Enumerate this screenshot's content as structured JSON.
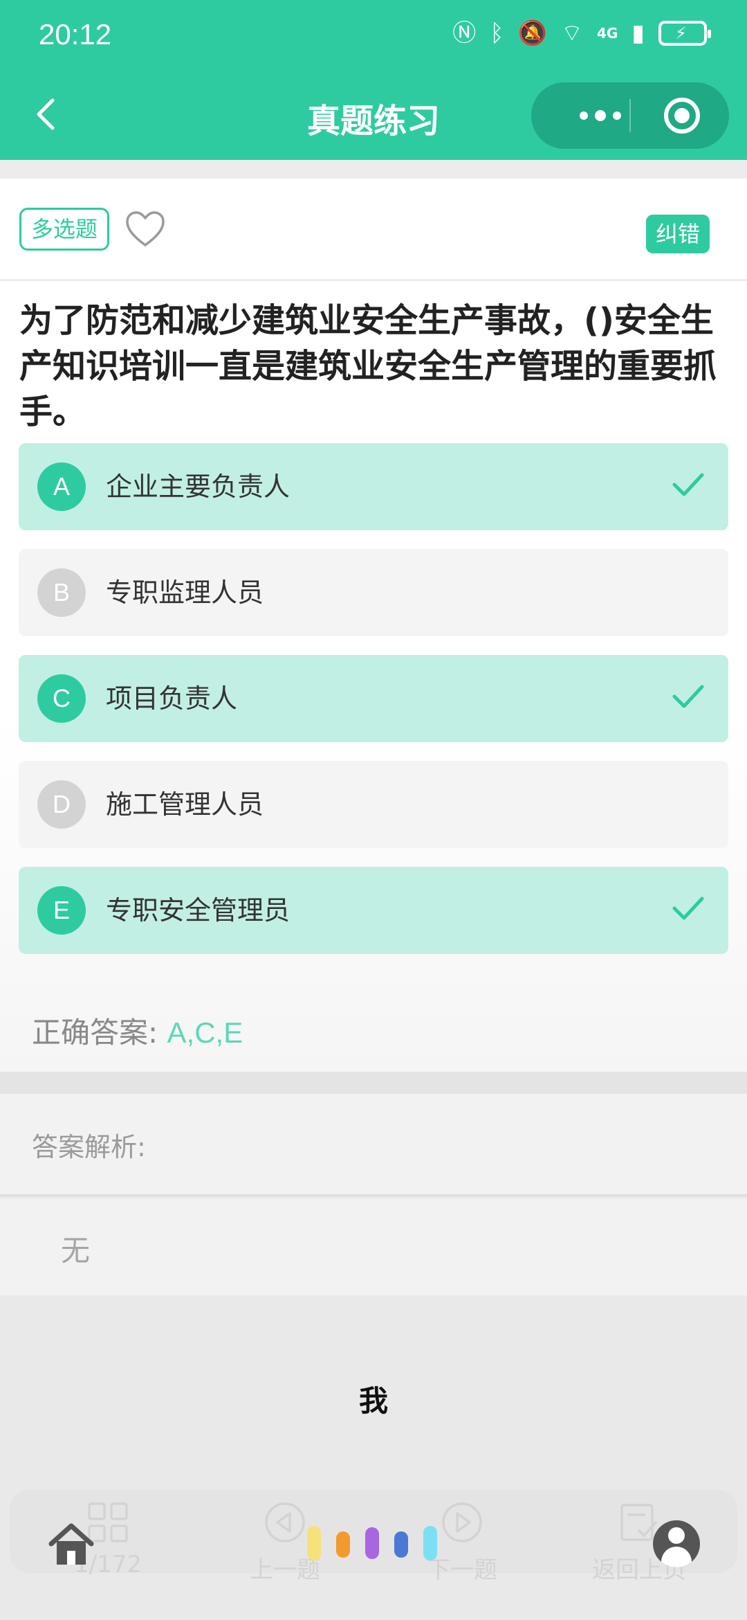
{
  "status": {
    "time": "20:12",
    "network": "4G",
    "icons": [
      "nfc-icon",
      "bluetooth-icon",
      "bell-muted-icon",
      "wifi-icon",
      "signal-icon",
      "battery-charging-icon"
    ]
  },
  "nav": {
    "title": "真题练习",
    "more_icon": "more-dots-icon",
    "close_icon": "target-icon"
  },
  "question": {
    "type_tag": "多选题",
    "correct_label": "纠错",
    "text": "为了防范和减少建筑业安全生产事故，()安全生产知识培训一直是建筑业安全生产管理的重要抓手。",
    "options": [
      {
        "letter": "A",
        "text": "企业主要负责人",
        "selected": true
      },
      {
        "letter": "B",
        "text": "专职监理人员",
        "selected": false
      },
      {
        "letter": "C",
        "text": "项目负责人",
        "selected": true
      },
      {
        "letter": "D",
        "text": "施工管理人员",
        "selected": false
      },
      {
        "letter": "E",
        "text": "专职安全管理员",
        "selected": true
      }
    ],
    "answer_label": "正确答案:",
    "answer_value": "A,C,E"
  },
  "analysis": {
    "label": "答案解析:",
    "content": "无"
  },
  "overlay": {
    "me_label": "我"
  },
  "tabbar": {
    "items": [
      {
        "icon": "grid-icon",
        "label": "1/172"
      },
      {
        "icon": "prev-icon",
        "label": "上一题"
      },
      {
        "icon": "next-icon",
        "label": "下一题"
      },
      {
        "icon": "checklist-icon",
        "label": "返回上页"
      }
    ]
  },
  "colors": {
    "accent": "#2ecba1",
    "selected_bg": "#c2efe4",
    "answer_text": "#5ed6b8"
  }
}
